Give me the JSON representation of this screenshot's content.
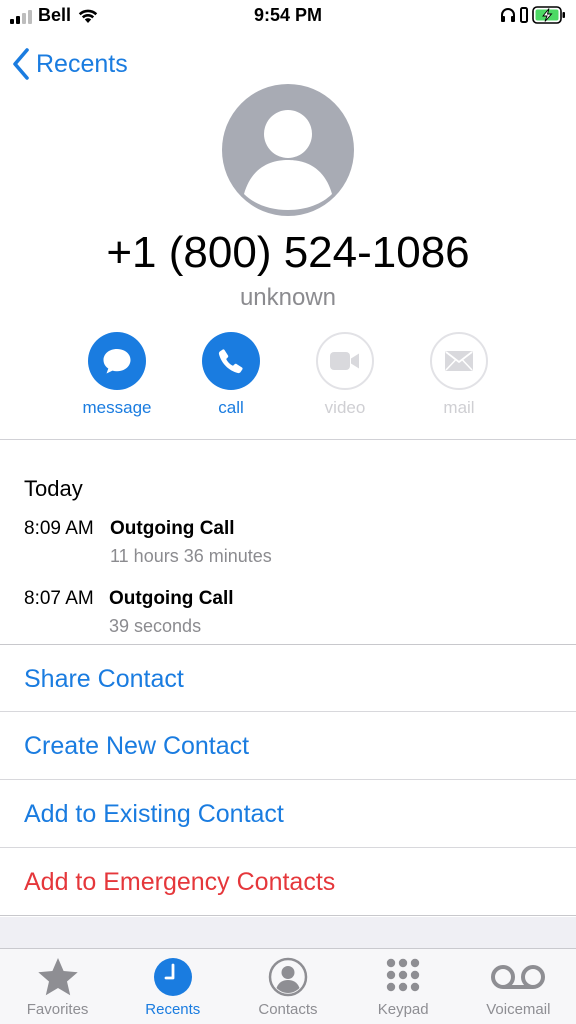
{
  "status_bar": {
    "carrier": "Bell",
    "time": "9:54 PM"
  },
  "nav": {
    "back_label": "Recents"
  },
  "contact": {
    "phone_number": "+1 (800) 524-1086",
    "label": "unknown"
  },
  "actions": [
    {
      "label": "message",
      "icon": "message-icon",
      "enabled": true
    },
    {
      "label": "call",
      "icon": "phone-icon",
      "enabled": true
    },
    {
      "label": "video",
      "icon": "video-icon",
      "enabled": false
    },
    {
      "label": "mail",
      "icon": "mail-icon",
      "enabled": false
    }
  ],
  "recents": {
    "day": "Today",
    "calls": [
      {
        "time": "8:09 AM",
        "type": "Outgoing Call",
        "duration": "11 hours 36 minutes"
      },
      {
        "time": "8:07 AM",
        "type": "Outgoing Call",
        "duration": "39 seconds"
      }
    ]
  },
  "options": [
    {
      "label": "Share Contact",
      "color": "#1a7ce0"
    },
    {
      "label": "Create New Contact",
      "color": "#1a7ce0"
    },
    {
      "label": "Add to Existing Contact",
      "color": "#1a7ce0"
    },
    {
      "label": "Add to Emergency Contacts",
      "color": "#e5373b"
    }
  ],
  "tabs": [
    {
      "label": "Favorites",
      "icon": "star-icon",
      "active": false
    },
    {
      "label": "Recents",
      "icon": "clock-icon",
      "active": true
    },
    {
      "label": "Contacts",
      "icon": "person-icon",
      "active": false
    },
    {
      "label": "Keypad",
      "icon": "keypad-icon",
      "active": false
    },
    {
      "label": "Voicemail",
      "icon": "voicemail-icon",
      "active": false
    }
  ],
  "colors": {
    "accent": "#1a7ce0",
    "destructive": "#e5373b",
    "secondary_text": "#8b8b8f",
    "battery_charging": "#4cd964"
  }
}
